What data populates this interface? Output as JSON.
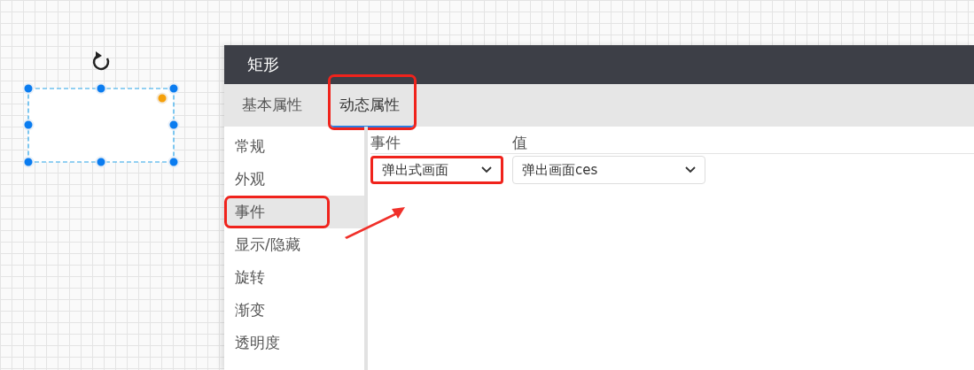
{
  "canvas": {
    "shape": {
      "selected": true
    }
  },
  "panel": {
    "title": "矩形",
    "tabs": [
      {
        "label": "基本属性",
        "selected": false,
        "annotated": false
      },
      {
        "label": "动态属性",
        "selected": true,
        "annotated": true
      }
    ],
    "menu": [
      {
        "label": "常规",
        "selected": false,
        "annotated": false
      },
      {
        "label": "外观",
        "selected": false,
        "annotated": false
      },
      {
        "label": "事件",
        "selected": true,
        "annotated": true
      },
      {
        "label": "显示/隐藏",
        "selected": false,
        "annotated": false
      },
      {
        "label": "旋转",
        "selected": false,
        "annotated": false
      },
      {
        "label": "渐变",
        "selected": false,
        "annotated": false
      },
      {
        "label": "透明度",
        "selected": false,
        "annotated": false
      }
    ],
    "table": {
      "columns": [
        "事件",
        "值"
      ],
      "rows": [
        {
          "event": "弹出式画面",
          "event_annotated": true,
          "value": "弹出画面ces"
        }
      ]
    }
  }
}
